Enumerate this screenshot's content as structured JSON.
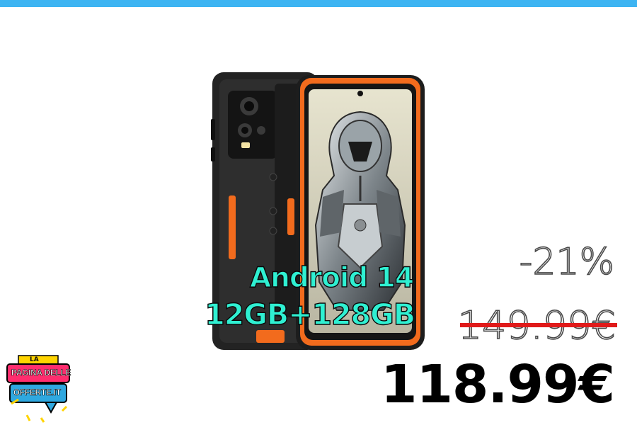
{
  "product": {
    "overlay_line1": "Android 14",
    "overlay_line2": "12GB+128GB",
    "accent_color": "#f26b1d",
    "overlay_text_color": "#2ff0d2"
  },
  "pricing": {
    "discount": "-21%",
    "original_price": "149.99€",
    "sale_price": "118.99€",
    "strike_color": "#e01a1a"
  },
  "logo": {
    "small_word": "LA",
    "line1": "PAGINA DELLE",
    "line2": "OFFERTE.IT"
  },
  "theme": {
    "top_bar_color": "#3db4f2"
  }
}
